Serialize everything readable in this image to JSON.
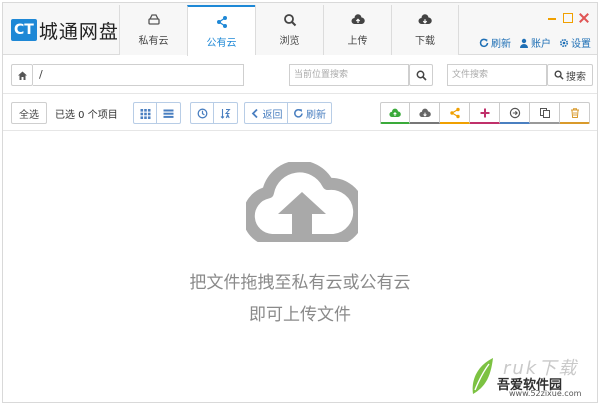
{
  "app": {
    "logo_badge": "CT",
    "logo_text": "城通网盘"
  },
  "nav": {
    "tabs": [
      {
        "label": "私有云",
        "icon": "drive-icon",
        "active": false
      },
      {
        "label": "公有云",
        "icon": "share-icon",
        "active": true
      },
      {
        "label": "浏览",
        "icon": "search-icon",
        "active": false
      },
      {
        "label": "上传",
        "icon": "cloud-upload-icon",
        "active": false
      },
      {
        "label": "下载",
        "icon": "cloud-download-icon",
        "active": false
      }
    ]
  },
  "toplinks": {
    "refresh": "刷新",
    "account": "账户",
    "settings": "设置"
  },
  "address": {
    "path": "/",
    "location_search_placeholder": "当前位置搜索",
    "file_search_placeholder": "文件搜索",
    "search_label": "搜索"
  },
  "toolbar": {
    "select_all": "全选",
    "selection_info": "已选 0 个项目",
    "back_label": "返回",
    "refresh_label": "刷新",
    "actions": [
      "cloud-upload-icon",
      "cloud-download-icon",
      "share-icon",
      "plus-icon",
      "circle-arrow-icon",
      "copy-icon",
      "trash-icon"
    ]
  },
  "empty_state": {
    "line1": "把文件拖拽至私有云或公有云",
    "line2": "即可上传文件"
  },
  "watermark": {
    "line1": "ruk下载",
    "line2": "吾爱软件园",
    "line3": "www.52zixue.com"
  },
  "colors": {
    "accent": "#1e88d6",
    "upload": "#3aaa3a",
    "share": "#f0a000",
    "plus": "#c0306a",
    "trash": "#d99a2b"
  }
}
